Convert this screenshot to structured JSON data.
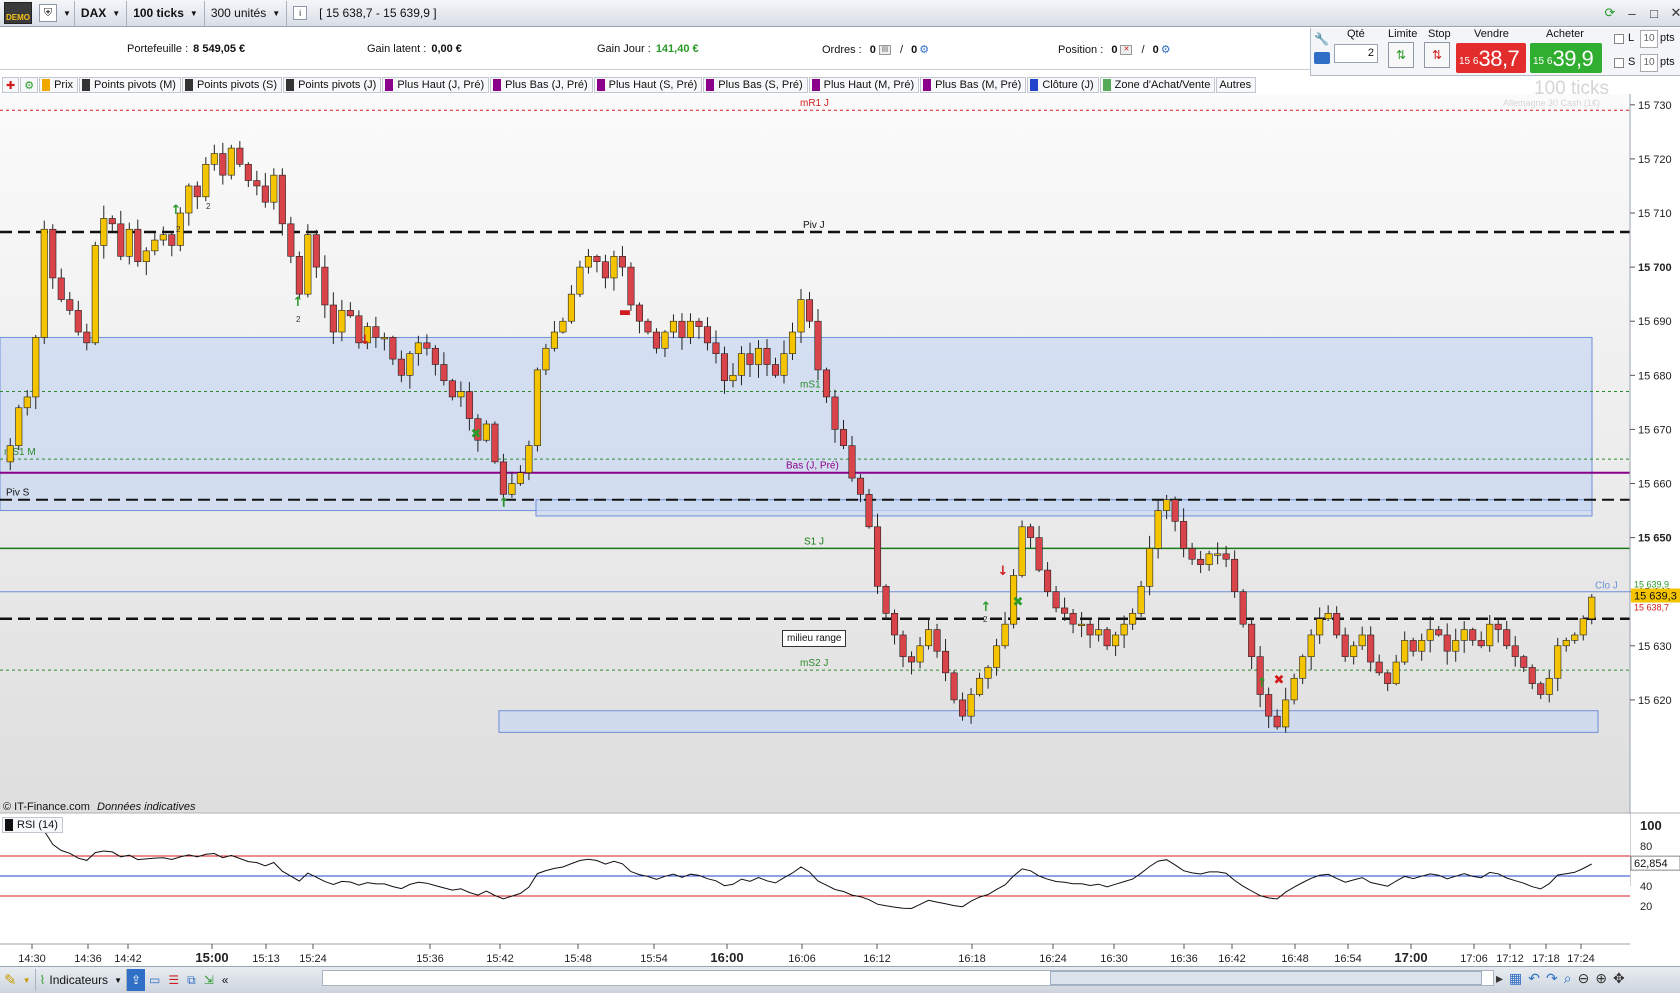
{
  "topbar": {
    "logo_text": "DEMO",
    "instrument": "DAX",
    "interval": "100 ticks",
    "units": "300 unités",
    "price_range": "[ 15 638,7 - 15 639,9 ]"
  },
  "info": {
    "portefeuille_label": "Portefeuille :",
    "portefeuille_value": "8 549,05 €",
    "gain_latent_label": "Gain latent :",
    "gain_latent_value": "0,00 €",
    "gain_jour_label": "Gain Jour :",
    "gain_jour_value": "141,40 €",
    "ordres_label": "Ordres :",
    "ordres_value_a": "0",
    "ordres_value_b": "0",
    "position_label": "Position :",
    "position_value_a": "0",
    "position_value_b": "0"
  },
  "order_panel": {
    "qte_label": "Qté",
    "qte_value": "2",
    "limite_label": "Limite",
    "stop_label": "Stop",
    "vendre_label": "Vendre",
    "acheter_label": "Acheter",
    "sell_small": "15 6",
    "sell_big": "38,7",
    "buy_small": "15 6",
    "buy_big": "39,9",
    "l_label": "L",
    "s_label": "S",
    "l_pts_value": "10",
    "s_pts_value": "10",
    "pts_label": "pts"
  },
  "indicator_tabs": [
    {
      "label": "Prix",
      "color": "#f0a800"
    },
    {
      "label": "Points pivots (M)",
      "color": "#333333"
    },
    {
      "label": "Points pivots (S)",
      "color": "#333333"
    },
    {
      "label": "Points pivots (J)",
      "color": "#333333"
    },
    {
      "label": "Plus Haut (J, Pré)",
      "color": "#8b008b"
    },
    {
      "label": "Plus Bas (J, Pré)",
      "color": "#8b008b"
    },
    {
      "label": "Plus Haut (S, Pré)",
      "color": "#8b008b"
    },
    {
      "label": "Plus Bas (S, Pré)",
      "color": "#8b008b"
    },
    {
      "label": "Plus Haut (M, Pré)",
      "color": "#8b008b"
    },
    {
      "label": "Plus Bas (M, Pré)",
      "color": "#8b008b"
    },
    {
      "label": "Clôture (J)",
      "color": "#2244cc"
    },
    {
      "label": "Zone d'Achat/Vente",
      "color": "#55aa55"
    },
    {
      "label": "Autres",
      "color": ""
    }
  ],
  "chart": {
    "watermark": "100 ticks",
    "watermark_sub": "Allemagne 30 Cash (1€)",
    "copyright": "© IT-Finance.com",
    "copyright_note": "Données indicatives",
    "last_price_label": "15 639,3",
    "label_above": "15 639,9",
    "label_below": "15 638,7",
    "clo_label": "Clo J",
    "milieu_label": "milieu range",
    "level_labels": {
      "mR1": "mR1 J",
      "pivj": "Piv J",
      "ms1j": "mS1 J",
      "ms1m": "mS1 M",
      "basj": "Bas (J, Pré)",
      "pivs": "Piv S",
      "s1j": "S1 J",
      "ms2j": "mS2 J"
    },
    "price_ticks": [
      "15 730",
      "15 720",
      "15 710",
      "15 700",
      "15 690",
      "15 680",
      "15 670",
      "15 660",
      "15 650",
      "15 640",
      "15 630",
      "15 620"
    ],
    "bold_ticks": [
      "15 700",
      "15 650"
    ],
    "time_labels": [
      "14:30",
      "14:36",
      "14:42",
      "15:00",
      "15:13",
      "15:24",
      "15:36",
      "15:42",
      "15:48",
      "15:54",
      "16:00",
      "16:06",
      "16:12",
      "16:18",
      "16:24",
      "16:30",
      "16:36",
      "16:42",
      "16:48",
      "16:54",
      "17:00",
      "17:06",
      "17:12",
      "17:18",
      "17:24"
    ],
    "bold_times": [
      "15:00",
      "16:00",
      "17:00"
    ],
    "marker_labels": [
      "2",
      "2",
      "2",
      "2"
    ]
  },
  "chart_data": {
    "type": "candlestick",
    "instrument": "DAX",
    "price_ylim": [
      15610,
      15732
    ],
    "levels": {
      "mR1 J": 15729,
      "Piv J": 15706.5,
      "mS1 J": 15677,
      "mS1 M": 15664.5,
      "Bas (J, Pré)": 15662,
      "Piv S": 15657,
      "S1 J": 15648,
      "milieu range": 15635,
      "mS2 J": 15625.5,
      "Clo J": 15640
    },
    "zones": [
      {
        "from_time": "14:30",
        "to_time": "17:24",
        "low": 15655,
        "high": 15687
      },
      {
        "from_time": "15:43",
        "to_time": "17:24",
        "low": 15654,
        "high": 15657
      },
      {
        "from_time": "15:42",
        "to_time": "17:24",
        "low": 15614,
        "high": 15618
      }
    ],
    "price_path": [
      15667,
      15674,
      15676,
      15687,
      15707,
      15698,
      15694,
      15692,
      15688,
      15686,
      15704,
      15709,
      15708,
      15702,
      15707,
      15701,
      15703,
      15705,
      15706,
      15704,
      15710,
      15715,
      15713,
      15719,
      15721,
      15717,
      15722,
      15719,
      15716,
      15715,
      15712,
      15717,
      15708,
      15702,
      15695,
      15706,
      15700,
      15693,
      15688,
      15692,
      15691,
      15686,
      15689,
      15687,
      15687,
      15683,
      15680,
      15684,
      15686,
      15685,
      15682,
      15679,
      15676,
      15677,
      15672,
      15668,
      15671,
      15664,
      15658,
      15660,
      15662,
      15667,
      15681,
      15685,
      15688,
      15690,
      15695,
      15700,
      15702,
      15701,
      15698,
      15702,
      15700,
      15693,
      15690,
      15688,
      15685,
      15688,
      15690,
      15687,
      15690,
      15689,
      15686,
      15684,
      15679,
      15680,
      15684,
      15682,
      15685,
      15682,
      15680,
      15684,
      15688,
      15694,
      15690,
      15681,
      15676,
      15670,
      15667,
      15661,
      15658,
      15652,
      15641,
      15636,
      15632,
      15628,
      15627,
      15630,
      15633,
      15629,
      15625,
      15620,
      15617,
      15621,
      15624,
      15626,
      15630,
      15634,
      15643,
      15652,
      15650,
      15644,
      15640,
      15637,
      15636,
      15634,
      15634,
      15632,
      15633,
      15630,
      15632,
      15634,
      15636,
      15641,
      15648,
      15655,
      15657,
      15653,
      15648,
      15646,
      15645,
      15647,
      15647,
      15646,
      15640,
      15634,
      15628,
      15621,
      15617,
      15615,
      15620,
      15624,
      15628,
      15632,
      15635,
      15636,
      15632,
      15628,
      15630,
      15632,
      15627,
      15625,
      15623,
      15627,
      15631,
      15629,
      15631,
      15633,
      15632,
      15629,
      15631,
      15633,
      15631,
      15630,
      15634,
      15633,
      15630,
      15628,
      15626,
      15623,
      15621,
      15624,
      15630,
      15631,
      15632,
      15635,
      15639
    ],
    "rsi": {
      "name": "RSI (14)",
      "period": 14,
      "last_label": "62,854",
      "last": 62.854,
      "ylim": [
        0,
        100
      ],
      "ticks": [
        "100",
        "80",
        "40",
        "20"
      ],
      "overbought": 70,
      "oversold": 30,
      "mid": 50
    },
    "time_axis": [
      "14:30",
      "14:36",
      "14:42",
      "15:00",
      "15:13",
      "15:24",
      "15:36",
      "15:42",
      "15:48",
      "15:54",
      "16:00",
      "16:06",
      "16:12",
      "16:18",
      "16:24",
      "16:30",
      "16:36",
      "16:42",
      "16:48",
      "16:54",
      "17:00",
      "17:06",
      "17:12",
      "17:18",
      "17:24"
    ]
  },
  "footer": {
    "indicateurs_label": "Indicateurs"
  },
  "colors": {
    "bull": "#f5c400",
    "bear": "#d9434a",
    "zone_fill": "#c9d8f2",
    "zone_border": "#6f8fd6",
    "rsi_line": "#111111",
    "rsi_ob": "#d01c1c",
    "rsi_os": "#d01c1c",
    "rsi_mid": "#2244cc",
    "pivot": "#111111",
    "mr": "#d01c1c",
    "ms": "#2a8a2a",
    "s1": "#1a7a1a",
    "bas": "#8b008b",
    "last_price_bg": "#f5c400"
  }
}
